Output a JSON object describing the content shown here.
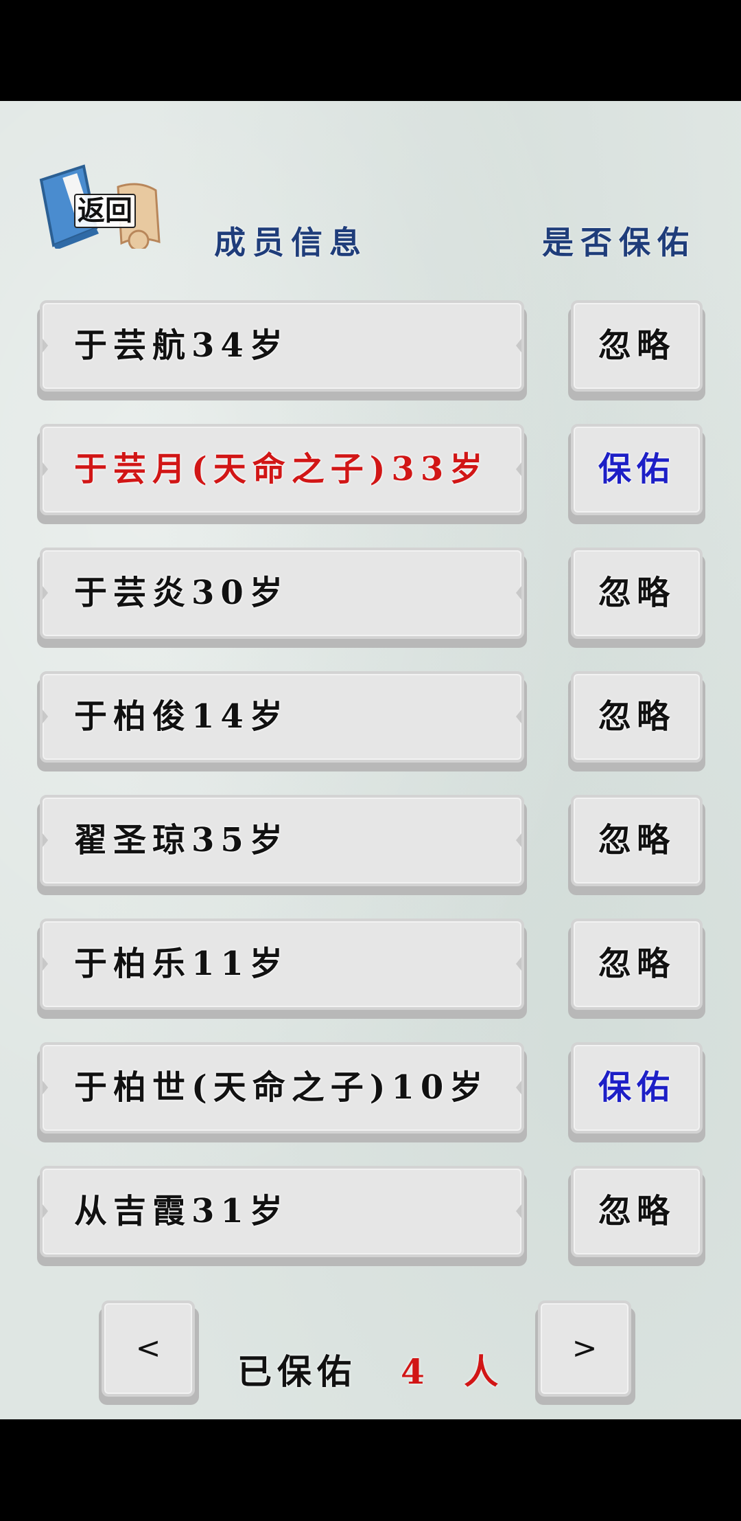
{
  "header": {
    "back_label": "返回",
    "members_title": "成员信息",
    "bless_title": "是否保佑"
  },
  "members": [
    {
      "text": "于芸航34岁",
      "action": "忽略",
      "highlight": false,
      "blessed": false
    },
    {
      "text": "于芸月(天命之子)33岁",
      "action": "保佑",
      "highlight": true,
      "blessed": true
    },
    {
      "text": "于芸炎30岁",
      "action": "忽略",
      "highlight": false,
      "blessed": false
    },
    {
      "text": "于柏俊14岁",
      "action": "忽略",
      "highlight": false,
      "blessed": false
    },
    {
      "text": "翟圣琼35岁",
      "action": "忽略",
      "highlight": false,
      "blessed": false
    },
    {
      "text": "于柏乐11岁",
      "action": "忽略",
      "highlight": false,
      "blessed": false
    },
    {
      "text": "于柏世(天命之子)10岁",
      "action": "保佑",
      "highlight": false,
      "blessed": true
    },
    {
      "text": "从吉霞31岁",
      "action": "忽略",
      "highlight": false,
      "blessed": false
    }
  ],
  "footer": {
    "prev_label": "<",
    "next_label": ">",
    "blessed_label": "已保佑",
    "blessed_count": "4 人"
  },
  "colors": {
    "header": "#1f3d7a",
    "highlight_red": "#d11616",
    "bless_blue": "#1d1fc6"
  }
}
